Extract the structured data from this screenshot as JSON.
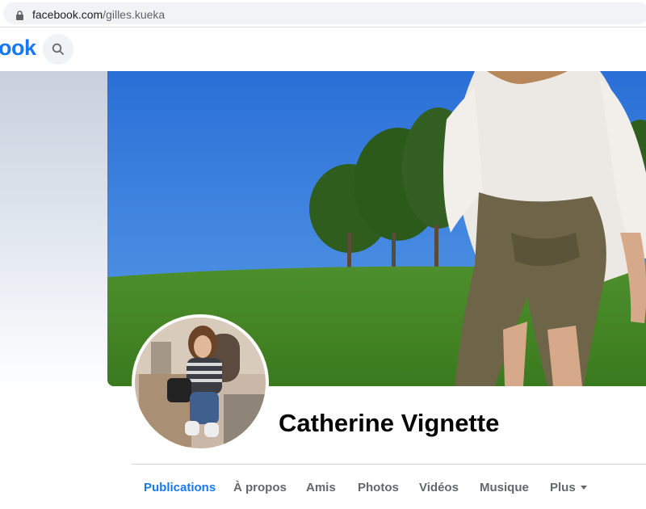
{
  "browser": {
    "url_domain": "facebook.com",
    "url_path": "/gilles.kueka"
  },
  "header": {
    "logo_text": "ook"
  },
  "profile": {
    "name": "Catherine Vignette"
  },
  "tabs": [
    {
      "label": "Publications",
      "active": true
    },
    {
      "label": "À propos",
      "active": false
    },
    {
      "label": "Amis",
      "active": false
    },
    {
      "label": "Photos",
      "active": false
    },
    {
      "label": "Vidéos",
      "active": false
    },
    {
      "label": "Musique",
      "active": false
    },
    {
      "label": "Plus",
      "active": false
    }
  ],
  "colors": {
    "brand": "#1877f2",
    "tab_text": "#65676b"
  },
  "icons": {
    "lock": "lock-icon",
    "search": "search-icon",
    "more": "caret-down-icon"
  }
}
